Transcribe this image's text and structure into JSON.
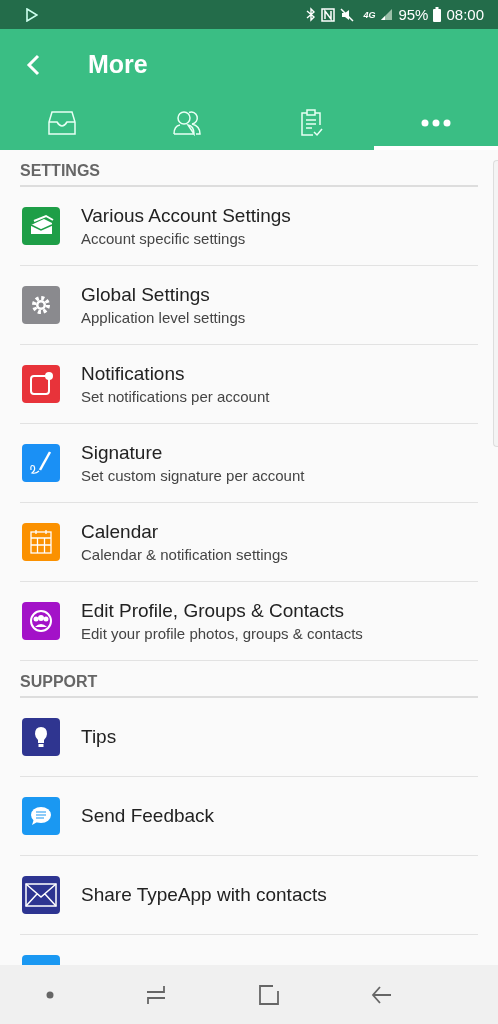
{
  "status_bar": {
    "network": "4G",
    "battery": "95%",
    "time": "08:00"
  },
  "app_bar": {
    "title": "More"
  },
  "tabs": [
    {
      "selected": false
    },
    {
      "selected": false
    },
    {
      "selected": false
    },
    {
      "selected": true
    }
  ],
  "sections": [
    {
      "header": "SETTINGS",
      "items": [
        {
          "title": "Various Account Settings",
          "subtitle": "Account specific settings",
          "color": "#1e9e47"
        },
        {
          "title": "Global Settings",
          "subtitle": "Application level settings",
          "color": "#8a8a8e"
        },
        {
          "title": "Notifications",
          "subtitle": "Set notifications per account",
          "color": "#e8333a"
        },
        {
          "title": "Signature",
          "subtitle": "Set custom signature per account",
          "color": "#1a90f5"
        },
        {
          "title": "Calendar",
          "subtitle": "Calendar & notification settings",
          "color": "#fb9100"
        },
        {
          "title": "Edit Profile, Groups & Contacts",
          "subtitle": "Edit your profile photos, groups & contacts",
          "color": "#a312c8"
        }
      ]
    },
    {
      "header": "SUPPORT",
      "items": [
        {
          "title": "Tips",
          "color": "#2f3590"
        },
        {
          "title": "Send Feedback",
          "color": "#1a98f2"
        },
        {
          "title": "Share TypeApp with contacts",
          "color": "#2d3491"
        },
        {
          "color": "#1a98f2"
        }
      ]
    }
  ]
}
